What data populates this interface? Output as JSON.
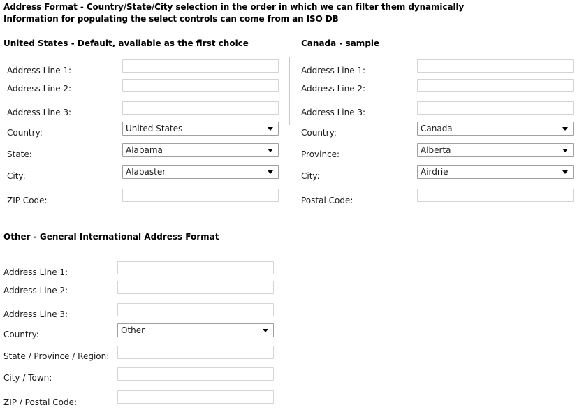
{
  "page": {
    "heading_line1": "Address Format - Country/State/City selection in the order in which we can filter them dynamically",
    "heading_line2": "Information for populating the select controls can come from an ISO DB"
  },
  "sections": {
    "us": {
      "heading": "United States - Default, available as the first choice",
      "rows": [
        {
          "label": "Address Line 1:",
          "type": "text",
          "value": ""
        },
        {
          "label": "Address Line 2:",
          "type": "text",
          "value": ""
        },
        {
          "label": "Address Line 3:",
          "type": "text",
          "value": ""
        },
        {
          "label": "Country:",
          "type": "select",
          "value": "United States"
        },
        {
          "label": "State:",
          "type": "select",
          "value": "Alabama"
        },
        {
          "label": "City:",
          "type": "select",
          "value": "Alabaster"
        },
        {
          "label": "ZIP Code:",
          "type": "text",
          "value": ""
        }
      ]
    },
    "canada": {
      "heading": "Canada - sample",
      "rows": [
        {
          "label": "Address Line 1:",
          "type": "text",
          "value": ""
        },
        {
          "label": "Address Line 2:",
          "type": "text",
          "value": ""
        },
        {
          "label": "Address Line 3:",
          "type": "text",
          "value": ""
        },
        {
          "label": "Country:",
          "type": "select",
          "value": "Canada"
        },
        {
          "label": "Province:",
          "type": "select",
          "value": "Alberta"
        },
        {
          "label": "City:",
          "type": "select",
          "value": "Airdrie"
        },
        {
          "label": "Postal Code:",
          "type": "text",
          "value": ""
        }
      ]
    },
    "other": {
      "heading": "Other - General International Address Format",
      "rows": [
        {
          "label": "Address Line 1:",
          "type": "text",
          "value": ""
        },
        {
          "label": "Address Line 2:",
          "type": "text",
          "value": ""
        },
        {
          "label": "Address Line 3:",
          "type": "text",
          "value": ""
        },
        {
          "label": "Country:",
          "type": "select",
          "value": "Other"
        },
        {
          "label": "State / Province / Region:",
          "type": "text",
          "value": ""
        },
        {
          "label": "City / Town:",
          "type": "text",
          "value": ""
        },
        {
          "label": "ZIP / Postal Code:",
          "type": "text",
          "value": ""
        }
      ]
    }
  },
  "icons": {
    "select_arrow": "chevron-down-icon"
  },
  "colors": {
    "background": "#ffffff",
    "text": "#000000",
    "text_input_border": "#d4d4d4",
    "select_border": "#a0a0a0",
    "divider": "#c9c9c9"
  }
}
